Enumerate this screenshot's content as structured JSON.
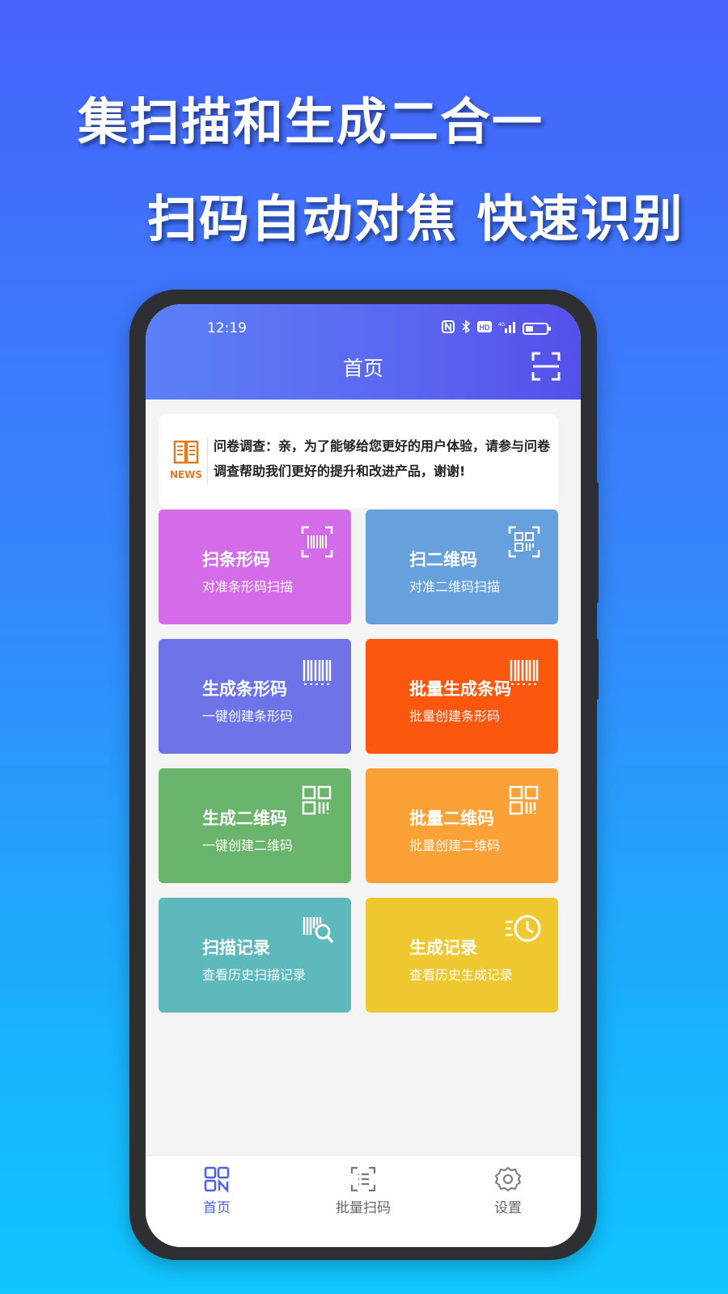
{
  "promo": {
    "line1": "集扫描和生成二合一",
    "line2": "扫码自动对焦 快速识别"
  },
  "status": {
    "time": "12:19",
    "battery": "low"
  },
  "appbar": {
    "title": "首页"
  },
  "news": {
    "badge": "NEWS",
    "text": "问卷调查：亲，为了能够给您更好的用户体验，请参与问卷调查帮助我们更好的提升和改进产品，谢谢!"
  },
  "cards": [
    {
      "title": "扫条形码",
      "subtitle": "对准条形码扫描",
      "color": "#d46ce9",
      "icon": "scan-barcode-icon"
    },
    {
      "title": "扫二维码",
      "subtitle": "对准二维码扫描",
      "color": "#66a0dd",
      "icon": "scan-qrcode-icon"
    },
    {
      "title": "生成条形码",
      "subtitle": "一键创建条形码",
      "color": "#6e73e8",
      "icon": "barcode-icon"
    },
    {
      "title": "批量生成条码",
      "subtitle": "批量创建条形码",
      "color": "#fb570e",
      "icon": "barcode-icon"
    },
    {
      "title": "生成二维码",
      "subtitle": "一键创建二维码",
      "color": "#6ab46b",
      "icon": "qrcode-icon"
    },
    {
      "title": "批量二维码",
      "subtitle": "批量创建二维码",
      "color": "#fba135",
      "icon": "qrcode-icon"
    },
    {
      "title": "扫描记录",
      "subtitle": "查看历史扫描记录",
      "color": "#5db9bc",
      "icon": "barcode-search-icon"
    },
    {
      "title": "生成记录",
      "subtitle": "查看历史生成记录",
      "color": "#efc830",
      "icon": "history-clock-icon"
    }
  ],
  "tabs": [
    {
      "label": "首页",
      "icon": "home-grid-icon",
      "active": true
    },
    {
      "label": "批量扫码",
      "icon": "batch-scan-icon",
      "active": false
    },
    {
      "label": "设置",
      "icon": "settings-gear-icon",
      "active": false
    }
  ]
}
